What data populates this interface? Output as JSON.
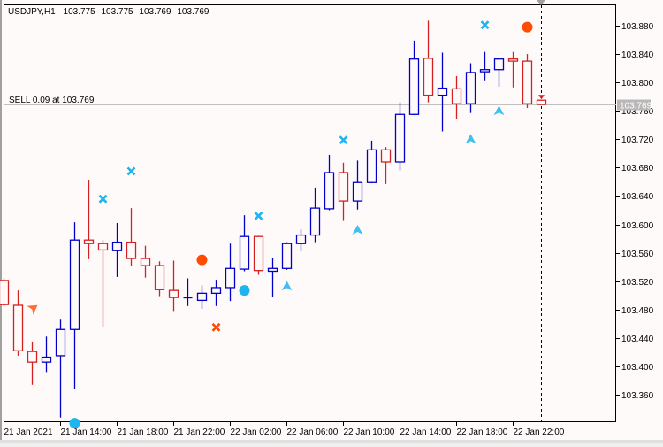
{
  "header": {
    "symbol_timeframe": "USDJPY,H1",
    "open": "103.775",
    "high": "103.775",
    "low": "103.769",
    "close": "103.769"
  },
  "order_line": {
    "label": "SELL 0.09 at 103.769",
    "price": 103.769,
    "price_label": "103.769",
    "color": "#c0c0c0"
  },
  "colors": {
    "background": "#fffafa",
    "bull": "#0000c8",
    "bear": "#d42020",
    "cyan_marker": "#1eb4f0",
    "orange_marker": "#ff4a00",
    "label_box": "#b8b8b8"
  },
  "chart_data": {
    "type": "candlestick",
    "ylim": [
      103.32,
      103.905
    ],
    "yticks": [
      "103.880",
      "103.840",
      "103.800",
      "103.760",
      "103.720",
      "103.680",
      "103.640",
      "103.600",
      "103.560",
      "103.520",
      "103.480",
      "103.440",
      "103.400",
      "103.360"
    ],
    "xticks": [
      {
        "time": "21 Jan 10:00",
        "label": "21 Jan 2021"
      },
      {
        "time": "21 Jan 14:00",
        "label": "21 Jan 14:00"
      },
      {
        "time": "21 Jan 18:00",
        "label": "21 Jan 18:00"
      },
      {
        "time": "21 Jan 22:00",
        "label": "21 Jan 22:00"
      },
      {
        "time": "22 Jan 02:00",
        "label": "22 Jan 02:00"
      },
      {
        "time": "22 Jan 06:00",
        "label": "22 Jan 06:00"
      },
      {
        "time": "22 Jan 10:00",
        "label": "22 Jan 10:00"
      },
      {
        "time": "22 Jan 14:00",
        "label": "22 Jan 14:00"
      },
      {
        "time": "22 Jan 18:00",
        "label": "22 Jan 18:00"
      },
      {
        "time": "22 Jan 22:00",
        "label": "22 Jan 22:00"
      }
    ],
    "day_separators": [
      "22 Jan 00:00",
      "23 Jan 00:00"
    ],
    "candles": [
      {
        "t": "21 Jan 10:00",
        "o": 103.521,
        "h": 103.524,
        "l": 103.485,
        "c": 103.487
      },
      {
        "t": "21 Jan 11:00",
        "o": 103.486,
        "h": 103.507,
        "l": 103.415,
        "c": 103.422
      },
      {
        "t": "21 Jan 12:00",
        "o": 103.421,
        "h": 103.435,
        "l": 103.374,
        "c": 103.406
      },
      {
        "t": "21 Jan 13:00",
        "o": 103.406,
        "h": 103.442,
        "l": 103.392,
        "c": 103.413
      },
      {
        "t": "21 Jan 14:00",
        "o": 103.415,
        "h": 103.467,
        "l": 103.328,
        "c": 103.452
      },
      {
        "t": "21 Jan 15:00",
        "o": 103.452,
        "h": 103.603,
        "l": 103.368,
        "c": 103.578
      },
      {
        "t": "21 Jan 16:00",
        "o": 103.578,
        "h": 103.663,
        "l": 103.551,
        "c": 103.573
      },
      {
        "t": "21 Jan 17:00",
        "o": 103.573,
        "h": 103.578,
        "l": 103.456,
        "c": 103.564
      },
      {
        "t": "21 Jan 18:00",
        "o": 103.563,
        "h": 103.602,
        "l": 103.526,
        "c": 103.575
      },
      {
        "t": "21 Jan 19:00",
        "o": 103.575,
        "h": 103.623,
        "l": 103.541,
        "c": 103.552
      },
      {
        "t": "21 Jan 20:00",
        "o": 103.552,
        "h": 103.57,
        "l": 103.525,
        "c": 103.542
      },
      {
        "t": "21 Jan 21:00",
        "o": 103.542,
        "h": 103.548,
        "l": 103.499,
        "c": 103.508
      },
      {
        "t": "21 Jan 22:00",
        "o": 103.507,
        "h": 103.549,
        "l": 103.478,
        "c": 103.497
      },
      {
        "t": "21 Jan 23:00",
        "o": 103.496,
        "h": 103.524,
        "l": 103.485,
        "c": 103.497
      },
      {
        "t": "22 Jan 00:00",
        "o": 103.493,
        "h": 103.514,
        "l": 103.481,
        "c": 103.503
      },
      {
        "t": "22 Jan 01:00",
        "o": 103.503,
        "h": 103.522,
        "l": 103.485,
        "c": 103.511
      },
      {
        "t": "22 Jan 02:00",
        "o": 103.511,
        "h": 103.573,
        "l": 103.492,
        "c": 103.538
      },
      {
        "t": "22 Jan 03:00",
        "o": 103.537,
        "h": 103.613,
        "l": 103.534,
        "c": 103.583
      },
      {
        "t": "22 Jan 04:00",
        "o": 103.583,
        "h": 103.584,
        "l": 103.529,
        "c": 103.535
      },
      {
        "t": "22 Jan 05:00",
        "o": 103.534,
        "h": 103.553,
        "l": 103.498,
        "c": 103.538
      },
      {
        "t": "22 Jan 06:00",
        "o": 103.538,
        "h": 103.575,
        "l": 103.536,
        "c": 103.573
      },
      {
        "t": "22 Jan 07:00",
        "o": 103.573,
        "h": 103.593,
        "l": 103.562,
        "c": 103.585
      },
      {
        "t": "22 Jan 08:00",
        "o": 103.585,
        "h": 103.652,
        "l": 103.575,
        "c": 103.623
      },
      {
        "t": "22 Jan 09:00",
        "o": 103.622,
        "h": 103.698,
        "l": 103.62,
        "c": 103.673
      },
      {
        "t": "22 Jan 10:00",
        "o": 103.673,
        "h": 103.687,
        "l": 103.605,
        "c": 103.633
      },
      {
        "t": "22 Jan 11:00",
        "o": 103.633,
        "h": 103.69,
        "l": 103.621,
        "c": 103.659
      },
      {
        "t": "22 Jan 12:00",
        "o": 103.659,
        "h": 103.718,
        "l": 103.658,
        "c": 103.705
      },
      {
        "t": "22 Jan 13:00",
        "o": 103.705,
        "h": 103.709,
        "l": 103.657,
        "c": 103.688
      },
      {
        "t": "22 Jan 14:00",
        "o": 103.688,
        "h": 103.772,
        "l": 103.676,
        "c": 103.755
      },
      {
        "t": "22 Jan 15:00",
        "o": 103.755,
        "h": 103.859,
        "l": 103.754,
        "c": 103.833
      },
      {
        "t": "22 Jan 16:00",
        "o": 103.834,
        "h": 103.887,
        "l": 103.772,
        "c": 103.782
      },
      {
        "t": "22 Jan 17:00",
        "o": 103.782,
        "h": 103.842,
        "l": 103.731,
        "c": 103.792
      },
      {
        "t": "22 Jan 18:00",
        "o": 103.791,
        "h": 103.809,
        "l": 103.749,
        "c": 103.77
      },
      {
        "t": "22 Jan 19:00",
        "o": 103.77,
        "h": 103.827,
        "l": 103.757,
        "c": 103.814
      },
      {
        "t": "22 Jan 20:00",
        "o": 103.815,
        "h": 103.843,
        "l": 103.803,
        "c": 103.818
      },
      {
        "t": "22 Jan 21:00",
        "o": 103.818,
        "h": 103.835,
        "l": 103.794,
        "c": 103.833
      },
      {
        "t": "22 Jan 22:00",
        "o": 103.833,
        "h": 103.843,
        "l": 103.793,
        "c": 103.83
      },
      {
        "t": "22 Jan 23:00",
        "o": 103.83,
        "h": 103.84,
        "l": 103.764,
        "c": 103.77
      },
      {
        "t": "23 Jan 00:00",
        "o": 103.775,
        "h": 103.775,
        "l": 103.769,
        "c": 103.769
      }
    ],
    "markers": [
      {
        "type": "cross",
        "color": "cyan",
        "t": "21 Jan 17:00",
        "price": 103.636
      },
      {
        "type": "cross",
        "color": "cyan",
        "t": "21 Jan 19:00",
        "price": 103.675
      },
      {
        "type": "cross",
        "color": "cyan",
        "t": "22 Jan 04:00",
        "price": 103.612
      },
      {
        "type": "cross",
        "color": "cyan",
        "t": "22 Jan 10:00",
        "price": 103.719
      },
      {
        "type": "cross",
        "color": "cyan",
        "t": "22 Jan 20:00",
        "price": 103.881
      },
      {
        "type": "cross",
        "color": "orange",
        "t": "22 Jan 01:00",
        "price": 103.455
      },
      {
        "type": "circle",
        "color": "orange",
        "t": "22 Jan 00:00",
        "price": 103.55
      },
      {
        "type": "circle",
        "color": "orange",
        "t": "22 Jan 23:00",
        "price": 103.878
      },
      {
        "type": "circle",
        "color": "cyan",
        "t": "22 Jan 03:00",
        "price": 103.507
      },
      {
        "type": "circle",
        "color": "cyan",
        "t": "21 Jan 15:00",
        "price": 103.32
      },
      {
        "type": "arrow-down",
        "color": "orange",
        "t": "21 Jan 12:00",
        "price": 103.48
      },
      {
        "type": "arrow-up",
        "color": "cyan",
        "t": "22 Jan 06:00",
        "price": 103.513
      },
      {
        "type": "arrow-up",
        "color": "cyan",
        "t": "22 Jan 11:00",
        "price": 103.592
      },
      {
        "type": "arrow-up",
        "color": "cyan",
        "t": "22 Jan 19:00",
        "price": 103.72
      },
      {
        "type": "arrow-up",
        "color": "cyan",
        "t": "22 Jan 21:00",
        "price": 103.76
      }
    ]
  }
}
